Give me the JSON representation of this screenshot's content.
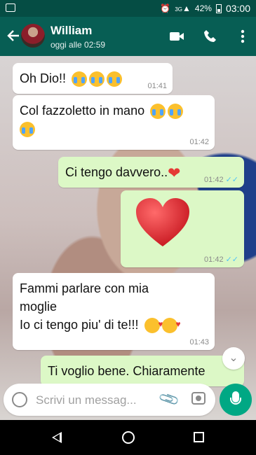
{
  "status_bar": {
    "signal_label": "3G",
    "battery": "42%",
    "time": "03:00"
  },
  "header": {
    "contact_name": "William",
    "last_seen": "oggi alle 02:59"
  },
  "messages": [
    {
      "direction": "in",
      "text": "Oh Dio!!",
      "emoji": [
        "loudly-crying-face",
        "loudly-crying-face",
        "loudly-crying-face"
      ],
      "time": "01:41"
    },
    {
      "direction": "in",
      "text": "Col fazzoletto in mano",
      "emoji": [
        "loudly-crying-face",
        "loudly-crying-face",
        "loudly-crying-face"
      ],
      "time": "01:42"
    },
    {
      "direction": "out",
      "text": "Ci tengo davvero..",
      "emoji": [
        "red-heart"
      ],
      "time": "01:42",
      "read": true
    },
    {
      "direction": "out",
      "text": "",
      "emoji": [
        "red-heart-large"
      ],
      "time": "01:42",
      "read": true
    },
    {
      "direction": "in",
      "text_line1": "Fammi parlare con mia",
      "text_line2": "moglie",
      "text_line3": "Io ci tengo piu' di te!!!",
      "emoji": [
        "face-blowing-kiss",
        "face-blowing-kiss"
      ],
      "time": "01:43"
    },
    {
      "direction": "out",
      "text": "Ti voglio bene. Chiaramente",
      "partial": true
    }
  ],
  "composer": {
    "placeholder": "Scrivi un messag..."
  },
  "colors": {
    "header": "#075e54",
    "status_bar": "#054d44",
    "outgoing": "#dcf8c6",
    "incoming": "#ffffff",
    "accent": "#00a884",
    "read_ticks": "#4fc3f7"
  }
}
